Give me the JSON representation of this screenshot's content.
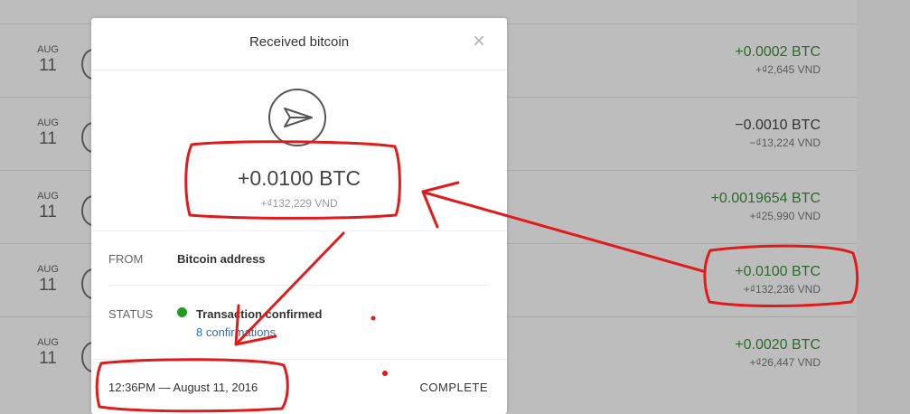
{
  "background_rows": [
    {
      "month": "AUG",
      "day": "11",
      "btc": "+0.0002 BTC",
      "vnd": "+₫2,645 VND",
      "direction": "pos"
    },
    {
      "month": "AUG",
      "day": "11",
      "btc": "−0.0010 BTC",
      "vnd": "−₫13,224 VND",
      "direction": "neg"
    },
    {
      "month": "AUG",
      "day": "11",
      "btc": "+0.0019654 BTC",
      "vnd": "+₫25,990 VND",
      "direction": "pos"
    },
    {
      "month": "AUG",
      "day": "11",
      "btc": "+0.0100 BTC",
      "vnd": "+₫132,236 VND",
      "direction": "pos"
    },
    {
      "month": "AUG",
      "day": "11",
      "btc": "+0.0020 BTC",
      "vnd": "+₫26,447 VND",
      "direction": "pos"
    }
  ],
  "modal": {
    "title": "Received bitcoin",
    "close_icon": "close-icon",
    "tx_icon": "paper-plane-icon",
    "amount_btc": "+0.0100 BTC",
    "amount_vnd": "+₫132,229 VND",
    "from_label": "FROM",
    "from_value": "Bitcoin address",
    "status_label": "STATUS",
    "status_value": "Transaction confirmed",
    "confirmations": "8 confirmations",
    "timestamp": "12:36PM — August 11, 2016",
    "footer_status": "COMPLETE"
  },
  "colors": {
    "positive": "#2c6a2c",
    "status_dot": "#1e9c1e",
    "link": "#2a6fb6",
    "annotation": "#e01b1b"
  }
}
